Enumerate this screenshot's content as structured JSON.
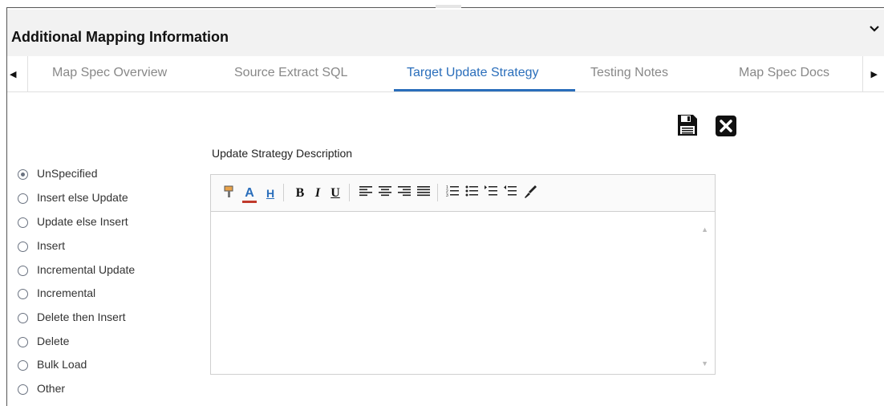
{
  "panel": {
    "title": "Additional Mapping Information"
  },
  "tabs": [
    {
      "label": "Map Spec Overview",
      "active": false
    },
    {
      "label": "Source Extract SQL",
      "active": false
    },
    {
      "label": "Target Update Strategy",
      "active": true
    },
    {
      "label": "Testing Notes",
      "active": false
    },
    {
      "label": "Map Spec Docs",
      "active": false
    }
  ],
  "form": {
    "description_label": "Update Strategy Description",
    "strategy_options": [
      {
        "label": "UnSpecified",
        "selected": true
      },
      {
        "label": "Insert else Update",
        "selected": false
      },
      {
        "label": "Update else Insert",
        "selected": false
      },
      {
        "label": "Insert",
        "selected": false
      },
      {
        "label": "Incremental Update",
        "selected": false
      },
      {
        "label": "Incremental",
        "selected": false
      },
      {
        "label": "Delete then Insert",
        "selected": false
      },
      {
        "label": "Delete",
        "selected": false
      },
      {
        "label": "Bulk Load",
        "selected": false
      },
      {
        "label": "Other",
        "selected": false
      }
    ],
    "description_value": ""
  },
  "toolbar": {
    "bold": "B",
    "italic": "I",
    "underline": "U",
    "font_color": "A",
    "highlight": "H"
  },
  "colors": {
    "accent": "#2a6ebb",
    "header_bg": "#f2f2f2",
    "font_color_bar": "#c0392b"
  },
  "icons": [
    "save-icon",
    "close-icon",
    "chevron-down-icon",
    "arrow-left-icon",
    "arrow-right-icon",
    "format-painter-icon",
    "font-color-icon",
    "highlight-icon",
    "bold-icon",
    "italic-icon",
    "underline-icon",
    "align-left-icon",
    "align-center-icon",
    "align-right-icon",
    "justify-icon",
    "numbered-list-icon",
    "bullet-list-icon",
    "indent-icon",
    "outdent-icon",
    "clear-format-icon"
  ]
}
